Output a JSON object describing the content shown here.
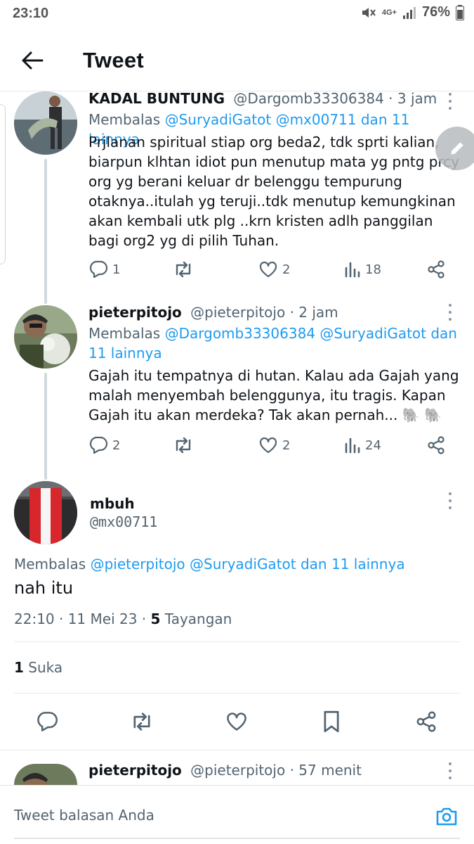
{
  "status_bar": {
    "time": "23:10",
    "network": "4G+",
    "battery": "76%"
  },
  "header": {
    "title": "Tweet"
  },
  "replies": [
    {
      "name": "KADAL BUNTUNG",
      "handle": "@Dargomb33306384 · 3 jam",
      "replying_prefix": "Membalas ",
      "replying_links": "@SuryadiGatot @mx00711 dan 11 lainnya",
      "text": "Prjlanan spiritual stiap org beda2, tdk sprti kalian, biarpun klhtan idiot pun menutup mata yg pntg prcy org yg berani keluar dr belenggu tempurung otaknya..itulah yg teruji..tdk menutup kemungkinan akan kembali utk plg ..krn kristen adlh panggilan bagi org2 yg di pilih Tuhan.",
      "reply_count": "1",
      "retweet_count": "",
      "like_count": "2",
      "view_count": "18"
    },
    {
      "name": "pieterpitojo",
      "handle": "@pieterpitojo · 2 jam",
      "replying_prefix": "Membalas ",
      "replying_links": "@Dargomb33306384 @SuryadiGatot dan 11 lainnya",
      "text": "Gajah itu tempatnya di hutan. Kalau ada Gajah yang malah menyembah belenggunya, itu tragis. Kapan Gajah itu akan merdeka? Tak akan pernah... 🐘 🐘",
      "reply_count": "2",
      "retweet_count": "",
      "like_count": "2",
      "view_count": "24"
    },
    {
      "name": "pieterpitojo",
      "handle": "@pieterpitojo · 57 menit"
    }
  ],
  "main_tweet": {
    "name": "mbuh",
    "handle": "@mx00711",
    "replying_prefix": "Membalas ",
    "replying_links": "@pieterpitojo @SuryadiGatot dan 11 lainnya",
    "text": "nah itu",
    "timestamp": "22:10 · 11 Mei 23 · ",
    "views_count": "5",
    "views_label": " Tayangan",
    "likes_count": "1",
    "likes_label": " Suka"
  },
  "compose": {
    "placeholder": "Tweet balasan Anda"
  },
  "colors": {
    "link": "#1d9bf0",
    "secondary_text": "#536471",
    "primary_text": "#0f1419"
  }
}
